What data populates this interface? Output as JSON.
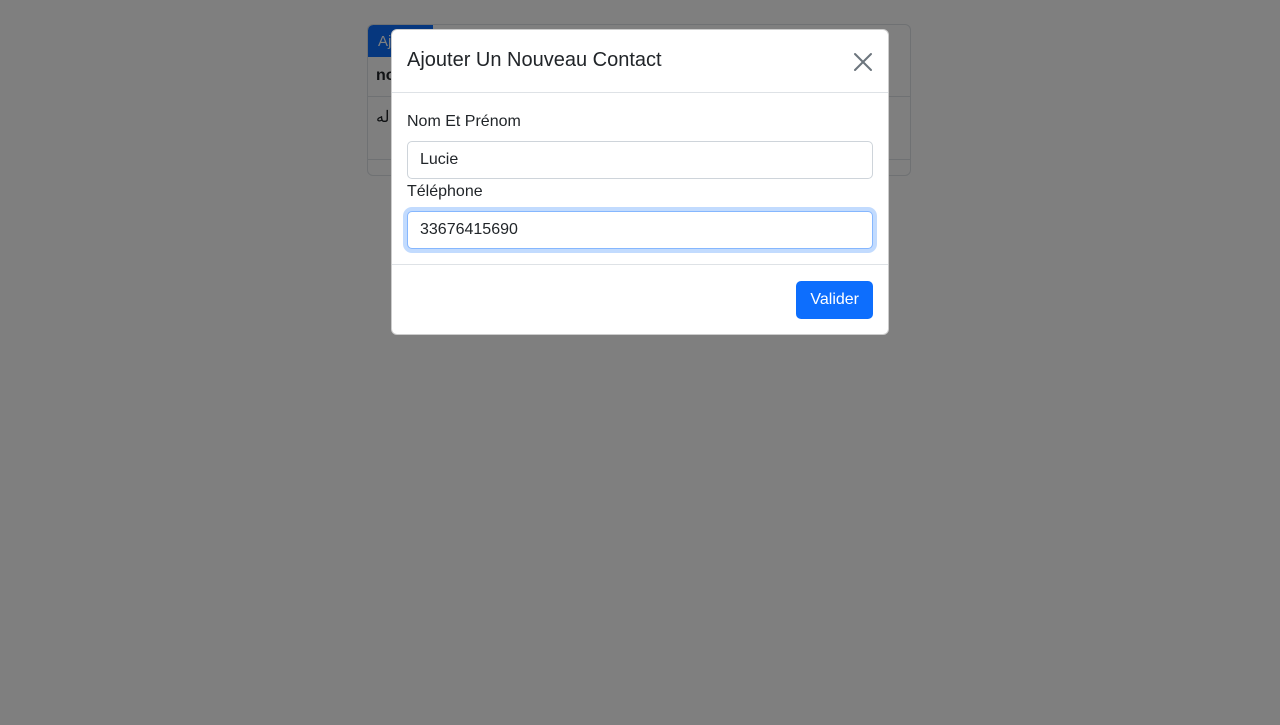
{
  "background": {
    "add_button_label": "Aj",
    "table": {
      "header_first": "no",
      "first_row_first_cell": "اله"
    }
  },
  "modal": {
    "title": "Ajouter Un Nouveau Contact",
    "close_icon": "close-icon",
    "name_field": {
      "label": "Nom Et Prénom",
      "value": "Lucie"
    },
    "phone_field": {
      "label": "Téléphone",
      "value": "33676415690"
    },
    "submit_label": "Valider"
  },
  "colors": {
    "primary": "#0d6efd",
    "backdrop": "#808080",
    "focus_border": "#86b7fe"
  }
}
